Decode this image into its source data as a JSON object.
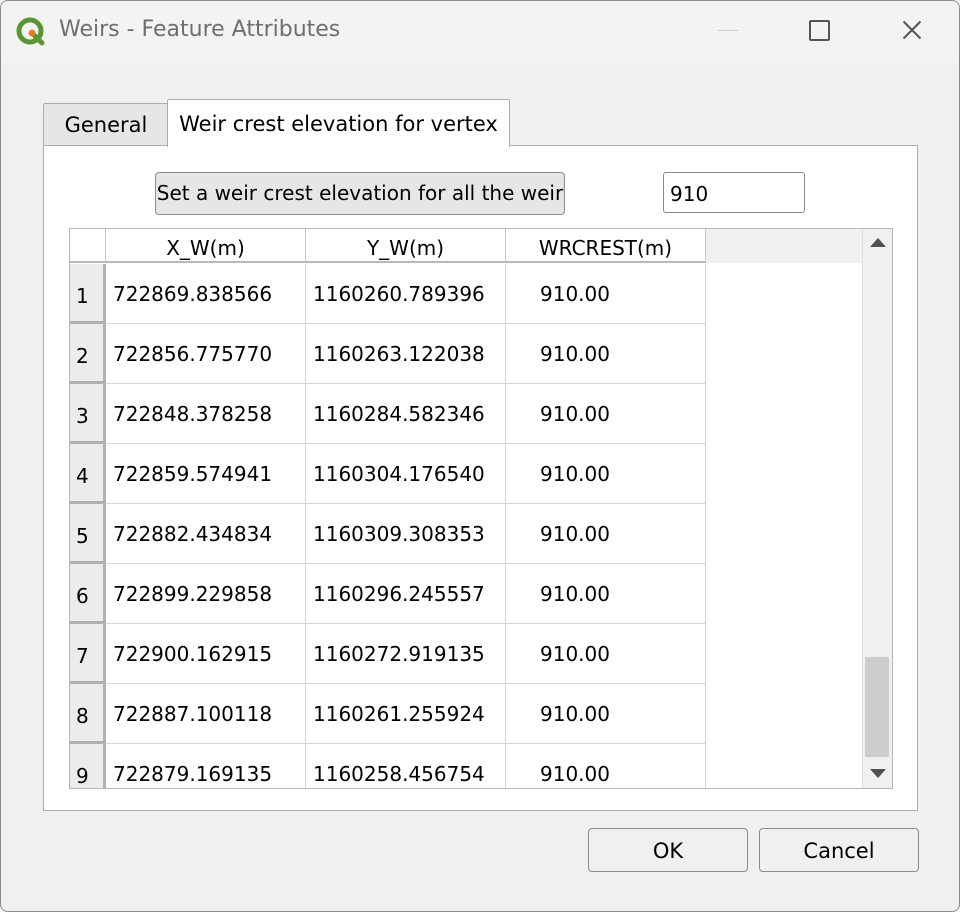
{
  "window": {
    "title": "Weirs - Feature Attributes",
    "app_icon": "qgis-logo-icon",
    "controls": [
      "minimize-icon",
      "maximize-icon",
      "close-icon"
    ]
  },
  "tabs": [
    {
      "label": "General",
      "active": false
    },
    {
      "label": "Weir crest elevation for vertex",
      "active": true
    }
  ],
  "set_all": {
    "button_label": "Set a weir crest elevation for all the weir",
    "value": "910"
  },
  "table": {
    "columns": [
      "X_W(m)",
      "Y_W(m)",
      "WRCREST(m)"
    ],
    "rows": [
      {
        "num": "1",
        "x": "722869.838566",
        "y": "1160260.789396",
        "wrcrest": "910.00"
      },
      {
        "num": "2",
        "x": "722856.775770",
        "y": "1160263.122038",
        "wrcrest": "910.00"
      },
      {
        "num": "3",
        "x": "722848.378258",
        "y": "1160284.582346",
        "wrcrest": "910.00"
      },
      {
        "num": "4",
        "x": "722859.574941",
        "y": "1160304.176540",
        "wrcrest": "910.00"
      },
      {
        "num": "5",
        "x": "722882.434834",
        "y": "1160309.308353",
        "wrcrest": "910.00"
      },
      {
        "num": "6",
        "x": "722899.229858",
        "y": "1160296.245557",
        "wrcrest": "910.00"
      },
      {
        "num": "7",
        "x": "722900.162915",
        "y": "1160272.919135",
        "wrcrest": "910.00"
      },
      {
        "num": "8",
        "x": "722887.100118",
        "y": "1160261.255924",
        "wrcrest": "910.00"
      },
      {
        "num": "9",
        "x": "722879.169135",
        "y": "1160258.456754",
        "wrcrest": "910.00"
      }
    ]
  },
  "buttons": {
    "ok": "OK",
    "cancel": "Cancel"
  }
}
